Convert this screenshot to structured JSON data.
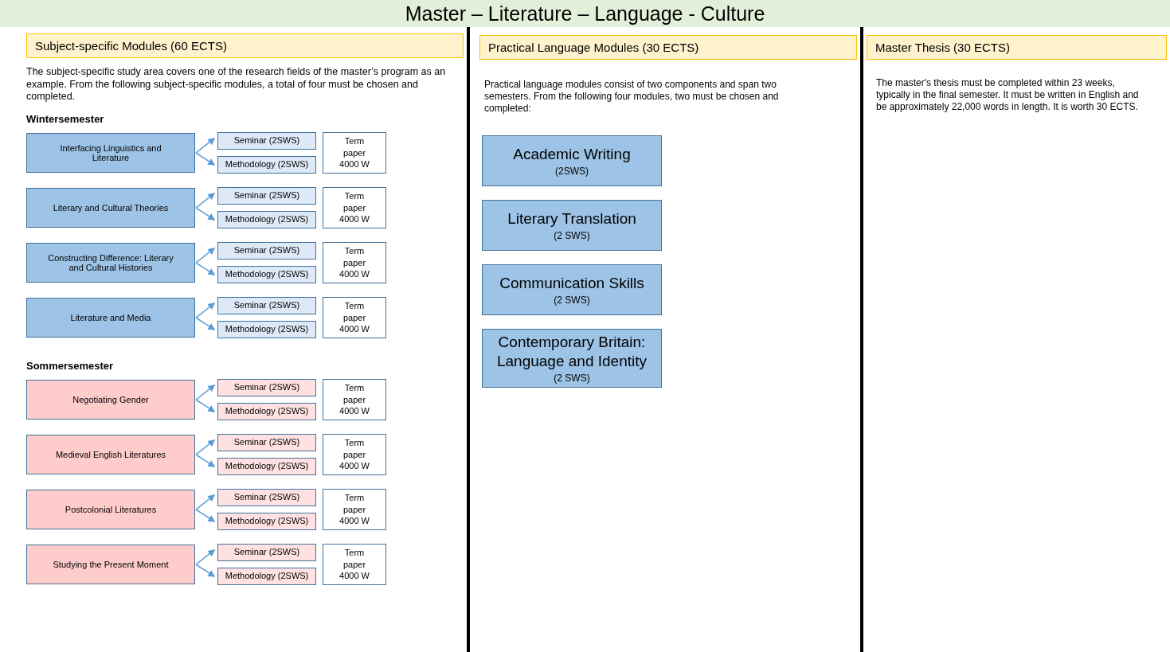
{
  "title": "Master – Literature – Language - Culture",
  "subject_modules": {
    "heading": "Subject-specific Modules (60 ECTS)",
    "description": "The subject-specific study area covers one of the research fields of the master’s program as an example. From the following subject-specific modules, a total of four must be chosen and completed.",
    "semesters": [
      {
        "name": "Wintersemester",
        "kind": "winter",
        "modules": [
          {
            "name": "Interfacing Linguistics and Literature",
            "components": [
              "Seminar (2SWS)",
              "Methodology (2SWS)"
            ],
            "assessment": "Term paper 4000 W"
          },
          {
            "name": "Literary and Cultural Theories",
            "components": [
              "Seminar (2SWS)",
              "Methodology (2SWS)"
            ],
            "assessment": "Term paper 4000 W"
          },
          {
            "name": "Constructing Difference: Literary and Cultural Histories",
            "components": [
              "Seminar (2SWS)",
              "Methodology (2SWS)"
            ],
            "assessment": "Term paper 4000 W"
          },
          {
            "name": "Literature and Media",
            "components": [
              "Seminar (2SWS)",
              "Methodology (2SWS)"
            ],
            "assessment": "Term paper 4000 W"
          }
        ]
      },
      {
        "name": "Sommersemester",
        "kind": "summer",
        "modules": [
          {
            "name": "Negotiating Gender",
            "components": [
              "Seminar (2SWS)",
              "Methodology (2SWS)"
            ],
            "assessment": "Term paper 4000 W"
          },
          {
            "name": "Medieval English Literatures",
            "components": [
              "Seminar (2SWS)",
              "Methodology (2SWS)"
            ],
            "assessment": "Term paper 4000 W"
          },
          {
            "name": "Postcolonial Literatures",
            "components": [
              "Seminar (2SWS)",
              "Methodology (2SWS)"
            ],
            "assessment": "Term paper 4000 W"
          },
          {
            "name": "Studying the Present Moment",
            "components": [
              "Seminar (2SWS)",
              "Methodology (2SWS)"
            ],
            "assessment": "Term paper 4000 W"
          }
        ]
      }
    ]
  },
  "language_modules": {
    "heading": "Practical Language Modules (30 ECTS)",
    "description": "Practical language modules consist of two components and span two semesters. From the following four modules, two must be chosen and completed:",
    "modules": [
      {
        "name": "Academic Writing",
        "hours": "(2SWS)"
      },
      {
        "name": "Literary Translation",
        "hours": "(2 SWS)"
      },
      {
        "name": "Communication Skills",
        "hours": "(2 SWS)"
      },
      {
        "name": "Contemporary Britain: Language and Identity",
        "hours": "(2 SWS)"
      }
    ]
  },
  "thesis": {
    "heading": "Master Thesis (30 ECTS)",
    "description": "The master's thesis must be completed within 23 weeks, typically in the final semester. It must be written in English and be approximately 22,000 words in length. It is worth 30 ECTS."
  }
}
